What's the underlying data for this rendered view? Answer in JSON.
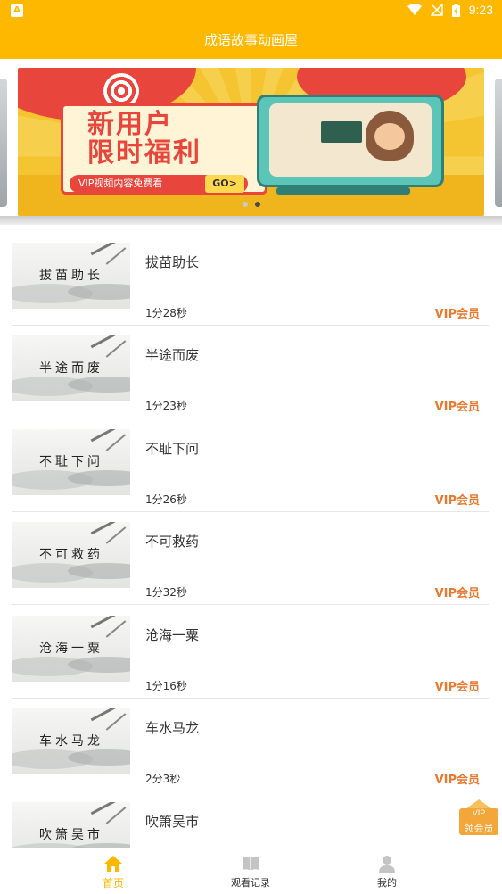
{
  "status_bar": {
    "time": "9:23",
    "app_badge": "A"
  },
  "header": {
    "title": "成语故事动画屋"
  },
  "banner": {
    "headline_line1": "新用户",
    "headline_line2": "限时福利",
    "subtitle": "VIP视频内容免费看",
    "go_label": "GO>",
    "page_count": 2,
    "active_page": 1
  },
  "list": {
    "items": [
      {
        "title": "拔苗助长",
        "duration": "1分28秒",
        "badge": "VIP会员"
      },
      {
        "title": "半途而废",
        "duration": "1分23秒",
        "badge": "VIP会员"
      },
      {
        "title": "不耻下问",
        "duration": "1分26秒",
        "badge": "VIP会员"
      },
      {
        "title": "不可救药",
        "duration": "1分32秒",
        "badge": "VIP会员"
      },
      {
        "title": "沧海一粟",
        "duration": "1分16秒",
        "badge": "VIP会员"
      },
      {
        "title": "车水马龙",
        "duration": "2分3秒",
        "badge": "VIP会员"
      },
      {
        "title": "吹箫吴市",
        "duration": "",
        "badge": ""
      }
    ]
  },
  "vip_float": {
    "top": "VIP",
    "bottom": "领会员"
  },
  "tabbar": {
    "tabs": [
      {
        "label": "首页",
        "icon": "home-icon",
        "active": true
      },
      {
        "label": "观看记录",
        "icon": "book-icon",
        "active": false
      },
      {
        "label": "我的",
        "icon": "person-icon",
        "active": false
      }
    ]
  },
  "colors": {
    "brand": "#FFB800",
    "vip": "#E8792F",
    "text": "#333333"
  }
}
